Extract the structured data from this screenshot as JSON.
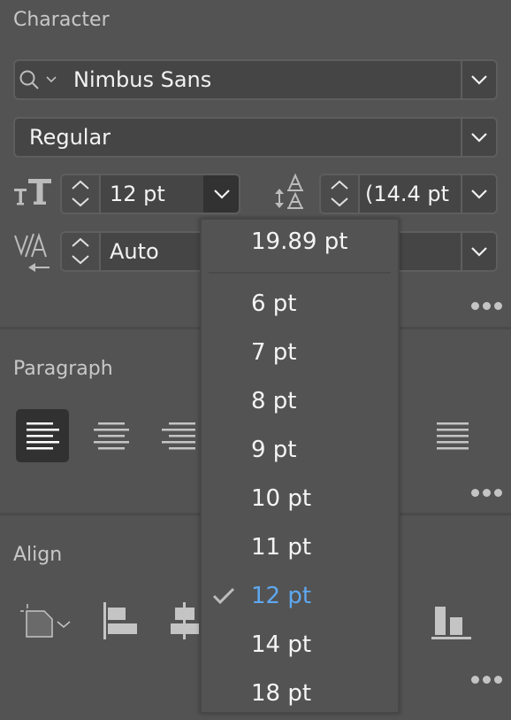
{
  "character": {
    "title": "Character",
    "font_family": "Nimbus Sans",
    "font_style": "Regular",
    "font_size": "12 pt",
    "leading": "(14.4 pt",
    "kerning": "Auto",
    "tracking": ""
  },
  "paragraph": {
    "title": "Paragraph",
    "alignments": [
      "align-left",
      "align-center",
      "align-right",
      "justify-left",
      "justify-center",
      "justify-right",
      "justify-all"
    ],
    "active_alignment": "align-left"
  },
  "align": {
    "title": "Align"
  },
  "font_size_menu": {
    "recent": "19.89 pt",
    "items": [
      {
        "label": "6 pt",
        "selected": false
      },
      {
        "label": "7 pt",
        "selected": false
      },
      {
        "label": "8 pt",
        "selected": false
      },
      {
        "label": "9 pt",
        "selected": false
      },
      {
        "label": "10 pt",
        "selected": false
      },
      {
        "label": "11 pt",
        "selected": false
      },
      {
        "label": "12 pt",
        "selected": true
      },
      {
        "label": "14 pt",
        "selected": false
      },
      {
        "label": "18 pt",
        "selected": false
      }
    ]
  },
  "colors": {
    "panel_bg": "#535353",
    "field_bg": "#454545",
    "selected_accent": "#5ea8f0"
  }
}
